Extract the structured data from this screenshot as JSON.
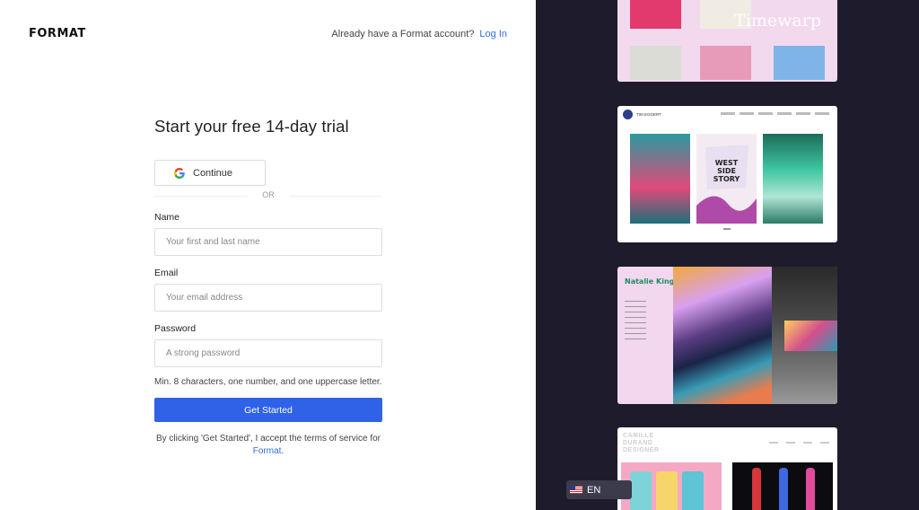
{
  "brand": {
    "logo": "FORMAT"
  },
  "header": {
    "prompt": "Already have a Format account?",
    "login_link": "Log In"
  },
  "signup": {
    "heading": "Start your free 14-day trial",
    "google_button": "Continue",
    "divider": "OR",
    "name": {
      "label": "Name",
      "placeholder": "Your first and last name",
      "value": ""
    },
    "email": {
      "label": "Email",
      "placeholder": "Your email address",
      "value": ""
    },
    "password": {
      "label": "Password",
      "placeholder": "A strong password",
      "value": ""
    },
    "password_hint": "Min. 8 characters, one number, and one uppercase letter.",
    "submit": "Get Started",
    "terms_text": "By clicking 'Get Started', I accept the terms of service for",
    "terms_link": "Format",
    "terms_end": "."
  },
  "showcase": {
    "card1_title": "Timewarp",
    "card2_name": "TIM EGGERT",
    "card2_poster": "WEST SIDE STORY",
    "card3_name": "Natalie King",
    "card4_title": "CAMILLE DURAND DESIGNER"
  },
  "language": {
    "code": "EN",
    "flag": "us-flag-icon"
  },
  "colors": {
    "accent": "#2f62e6",
    "link": "#2f6fe0",
    "panel": "#1d1b2c"
  }
}
